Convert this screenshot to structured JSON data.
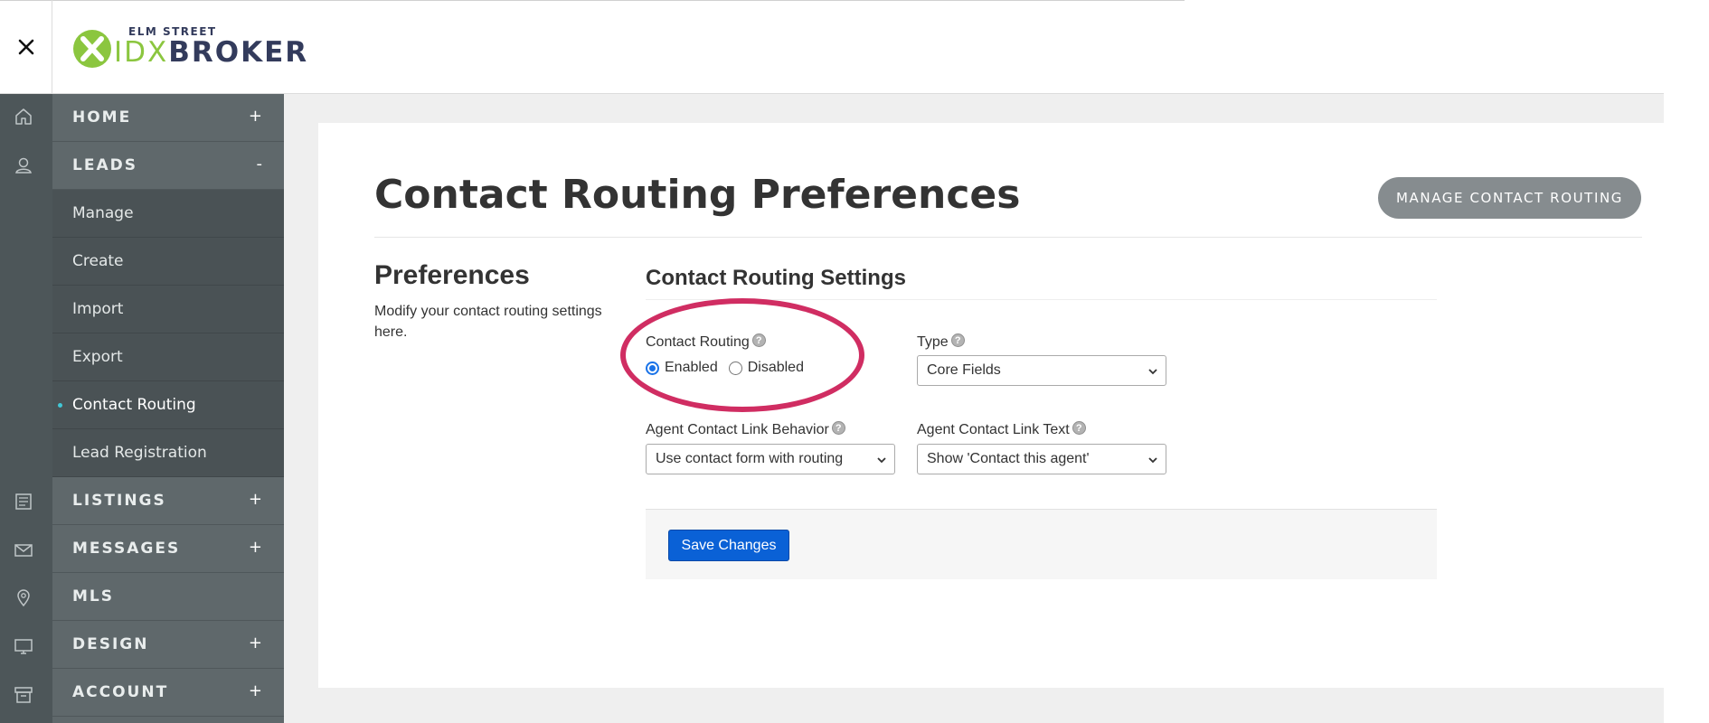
{
  "header": {
    "logo": {
      "small_text": "ELM STREET",
      "brand_idx": "IDX",
      "brand_broker": "BROKER",
      "icon": "idx-x-logo-icon"
    },
    "close_icon": "close-icon"
  },
  "rail": {
    "icons": [
      "home-icon",
      "user-icon",
      "listings-icon",
      "mail-icon",
      "map-pin-icon",
      "monitor-icon",
      "archive-icon"
    ]
  },
  "sidebar": {
    "home": {
      "label": "HOME",
      "sign": "+"
    },
    "leads": {
      "label": "LEADS",
      "sign": "-"
    },
    "leads_items": [
      {
        "label": "Manage"
      },
      {
        "label": "Create"
      },
      {
        "label": "Import"
      },
      {
        "label": "Export"
      },
      {
        "label": "Contact Routing",
        "active": true
      },
      {
        "label": "Lead Registration"
      }
    ],
    "listings": {
      "label": "LISTINGS",
      "sign": "+"
    },
    "messages": {
      "label": "MESSAGES",
      "sign": "+"
    },
    "mls": {
      "label": "MLS"
    },
    "design": {
      "label": "DESIGN",
      "sign": "+"
    },
    "account": {
      "label": "ACCOUNT",
      "sign": "+"
    }
  },
  "main": {
    "title": "Contact Routing Preferences",
    "manage_button": "MANAGE CONTACT ROUTING",
    "preferences": {
      "heading": "Preferences",
      "description": "Modify your contact routing settings here."
    },
    "settings": {
      "title": "Contact Routing Settings",
      "help_glyph": "?",
      "contact_routing": {
        "label": "Contact Routing",
        "options": [
          "Enabled",
          "Disabled"
        ],
        "selected": "Enabled"
      },
      "type": {
        "label": "Type",
        "value": "Core Fields"
      },
      "agent_link_behavior": {
        "label": "Agent Contact Link Behavior",
        "value": "Use contact form with routing"
      },
      "agent_link_text": {
        "label": "Agent Contact Link Text",
        "value": "Show 'Contact this agent'"
      },
      "save_button": "Save Changes"
    }
  },
  "colors": {
    "highlight": "#d02d62",
    "primary_button": "#0a61d6",
    "sidebar": "#5f686b",
    "sidebar_sub": "#4a5255",
    "rail": "#4d5659",
    "active_dot": "#41c7d6",
    "logo_green": "#8bc63f",
    "logo_navy": "#333b5c"
  }
}
